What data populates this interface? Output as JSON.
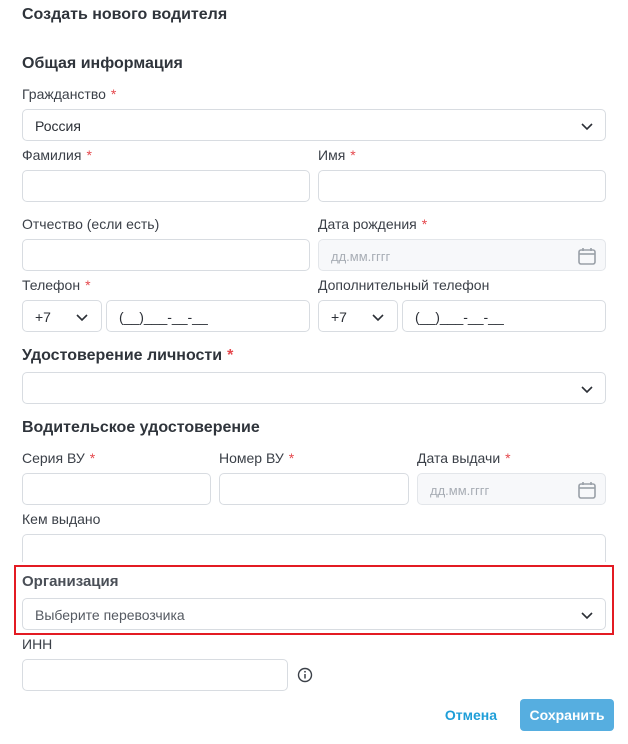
{
  "dialog": {
    "title": "Создать нового водителя"
  },
  "general": {
    "heading": "Общая информация",
    "citizenship": {
      "label": "Гражданство",
      "value": "Россия"
    },
    "last_name": {
      "label": "Фамилия",
      "value": ""
    },
    "first_name": {
      "label": "Имя",
      "value": ""
    },
    "patronymic": {
      "label": "Отчество (если есть)",
      "value": ""
    },
    "birth_date": {
      "label": "Дата рождения",
      "placeholder": "дд.мм.гггг"
    },
    "phone": {
      "label": "Телефон",
      "code": "+7",
      "mask": "(__)___-__-__"
    },
    "extra_phone": {
      "label": "Дополнительный телефон",
      "code": "+7",
      "mask": "(__)___-__-__"
    }
  },
  "identity": {
    "heading": "Удостоверение личности",
    "value": ""
  },
  "license": {
    "heading": "Водительское удостоверение",
    "series": {
      "label": "Серия ВУ",
      "value": ""
    },
    "number": {
      "label": "Номер ВУ",
      "value": ""
    },
    "issue_date": {
      "label": "Дата выдачи",
      "placeholder": "дд.мм.гггг"
    },
    "issued_by": {
      "label": "Кем выдано",
      "value": ""
    }
  },
  "organization": {
    "label": "Организация",
    "placeholder": "Выберите перевозчика"
  },
  "inn": {
    "label": "ИНН",
    "value": "",
    "info_icon": "info-icon"
  },
  "actions": {
    "cancel": "Отмена",
    "save": "Сохранить"
  },
  "colors": {
    "required": "#e5484d",
    "accent": "#1e9ed8",
    "save_bg": "#56aee0",
    "highlight": "#e31b23"
  }
}
